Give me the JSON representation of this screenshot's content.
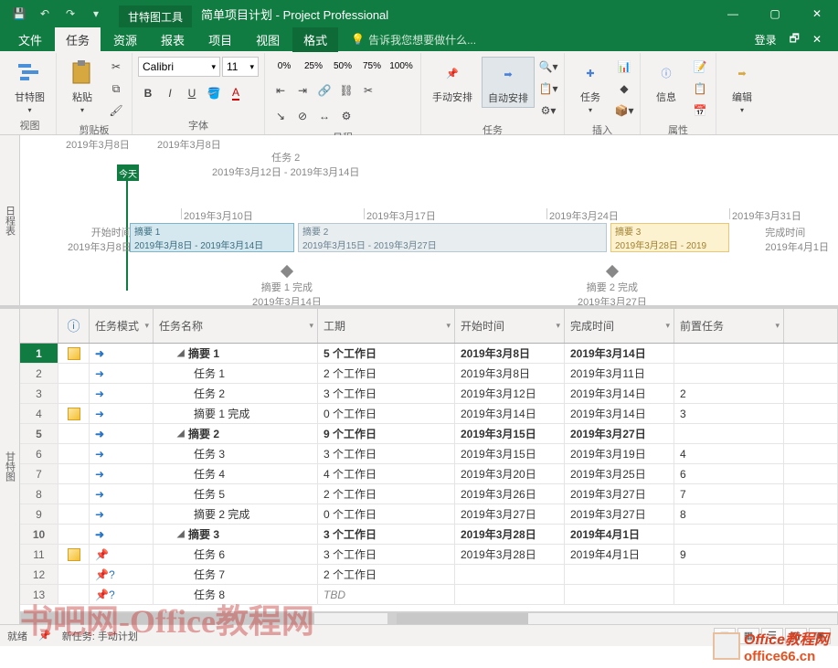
{
  "titlebar": {
    "tool_tab": "甘特图工具",
    "doc_title": "简单项目计划 - Project Professional"
  },
  "ribbon_tabs": {
    "file": "文件",
    "task": "任务",
    "resource": "资源",
    "report": "报表",
    "project": "项目",
    "view": "视图",
    "format": "格式",
    "tell_me": "告诉我您想要做什么...",
    "login": "登录"
  },
  "ribbon": {
    "view_group": "视图",
    "gantt_btn": "甘特图",
    "clipboard_group": "剪贴板",
    "paste_btn": "粘贴",
    "font_group": "字体",
    "font_name": "Calibri",
    "font_size": "11",
    "schedule_group": "日程",
    "pct0": "0%",
    "pct25": "25%",
    "pct50": "50%",
    "pct75": "75%",
    "pct100": "100%",
    "manual": "手动安排",
    "auto": "自动安排",
    "tasks_group": "任务",
    "task_btn": "任务",
    "insert_group": "插入",
    "info_btn": "信息",
    "properties_group": "属性",
    "edit_btn": "编辑"
  },
  "timeline": {
    "pane_label": "日程表",
    "date_l": "2019年3月8日",
    "date_r": "2019年3月8日",
    "today": "今天",
    "task2_label": "任务 2",
    "task2_range": "2019年3月12日 - 2019年3月14日",
    "tick1": "2019年3月10日",
    "tick2": "2019年3月17日",
    "tick3": "2019年3月24日",
    "tick4": "2019年3月31日",
    "start_label": "开始时间",
    "start_date": "2019年3月8日",
    "end_label": "完成时间",
    "end_date": "2019年4月1日",
    "s1_title": "摘要 1",
    "s1_range": "2019年3月8日 - 2019年3月14日",
    "s2_title": "摘要 2",
    "s2_range": "2019年3月15日 - 2019年3月27日",
    "s3_title": "摘要 3",
    "s3_range": "2019年3月28日 - 2019",
    "ms1_title": "摘要 1 完成",
    "ms1_date": "2019年3月14日",
    "ms2_title": "摘要 2 完成",
    "ms2_date": "2019年3月27日"
  },
  "grid": {
    "pane_label": "甘特图",
    "headers": {
      "indicator": "ⓘ",
      "mode": "任务模式",
      "name": "任务名称",
      "duration": "工期",
      "start": "开始时间",
      "finish": "完成时间",
      "pred": "前置任务"
    },
    "rows": [
      {
        "id": "1",
        "ind": "warn",
        "mode": "auto",
        "summary": true,
        "indent": 1,
        "name": "摘要 1",
        "dur": "5 个工作日",
        "start": "2019年3月8日",
        "finish": "2019年3月14日",
        "pred": "",
        "sel": true
      },
      {
        "id": "2",
        "ind": "",
        "mode": "auto",
        "summary": false,
        "indent": 2,
        "name": "任务 1",
        "dur": "2 个工作日",
        "start": "2019年3月8日",
        "finish": "2019年3月11日",
        "pred": ""
      },
      {
        "id": "3",
        "ind": "",
        "mode": "auto",
        "summary": false,
        "indent": 2,
        "name": "任务 2",
        "dur": "3 个工作日",
        "start": "2019年3月12日",
        "finish": "2019年3月14日",
        "pred": "2"
      },
      {
        "id": "4",
        "ind": "warn",
        "mode": "auto",
        "summary": false,
        "indent": 2,
        "name": "摘要 1 完成",
        "dur": "0 个工作日",
        "start": "2019年3月14日",
        "finish": "2019年3月14日",
        "pred": "3"
      },
      {
        "id": "5",
        "ind": "",
        "mode": "auto",
        "summary": true,
        "indent": 1,
        "name": "摘要 2",
        "dur": "9 个工作日",
        "start": "2019年3月15日",
        "finish": "2019年3月27日",
        "pred": ""
      },
      {
        "id": "6",
        "ind": "",
        "mode": "auto",
        "summary": false,
        "indent": 2,
        "name": "任务 3",
        "dur": "3 个工作日",
        "start": "2019年3月15日",
        "finish": "2019年3月19日",
        "pred": "4"
      },
      {
        "id": "7",
        "ind": "",
        "mode": "auto",
        "summary": false,
        "indent": 2,
        "name": "任务 4",
        "dur": "4 个工作日",
        "start": "2019年3月20日",
        "finish": "2019年3月25日",
        "pred": "6"
      },
      {
        "id": "8",
        "ind": "",
        "mode": "auto",
        "summary": false,
        "indent": 2,
        "name": "任务 5",
        "dur": "2 个工作日",
        "start": "2019年3月26日",
        "finish": "2019年3月27日",
        "pred": "7"
      },
      {
        "id": "9",
        "ind": "",
        "mode": "auto",
        "summary": false,
        "indent": 2,
        "name": "摘要 2 完成",
        "dur": "0 个工作日",
        "start": "2019年3月27日",
        "finish": "2019年3月27日",
        "pred": "8"
      },
      {
        "id": "10",
        "ind": "",
        "mode": "auto",
        "summary": true,
        "indent": 1,
        "name": "摘要 3",
        "dur": "3 个工作日",
        "start": "2019年3月28日",
        "finish": "2019年4月1日",
        "pred": ""
      },
      {
        "id": "11",
        "ind": "warn",
        "mode": "pin",
        "summary": false,
        "indent": 2,
        "name": "任务 6",
        "dur": "3 个工作日",
        "start": "2019年3月28日",
        "finish": "2019年4月1日",
        "pred": "9"
      },
      {
        "id": "12",
        "ind": "",
        "mode": "q",
        "summary": false,
        "indent": 2,
        "name": "任务 7",
        "dur": "2 个工作日",
        "start": "",
        "finish": "",
        "pred": ""
      },
      {
        "id": "13",
        "ind": "",
        "mode": "q",
        "summary": false,
        "indent": 2,
        "name": "任务 8",
        "dur": "TBD",
        "start": "",
        "finish": "",
        "pred": "",
        "italic": true
      }
    ]
  },
  "statusbar": {
    "ready": "就绪",
    "new_task": "新任务: 手动计划"
  },
  "watermark": {
    "text1": "书吧网-Office教程网",
    "brand1": "Office教程网",
    "brand2": "office66.cn"
  }
}
